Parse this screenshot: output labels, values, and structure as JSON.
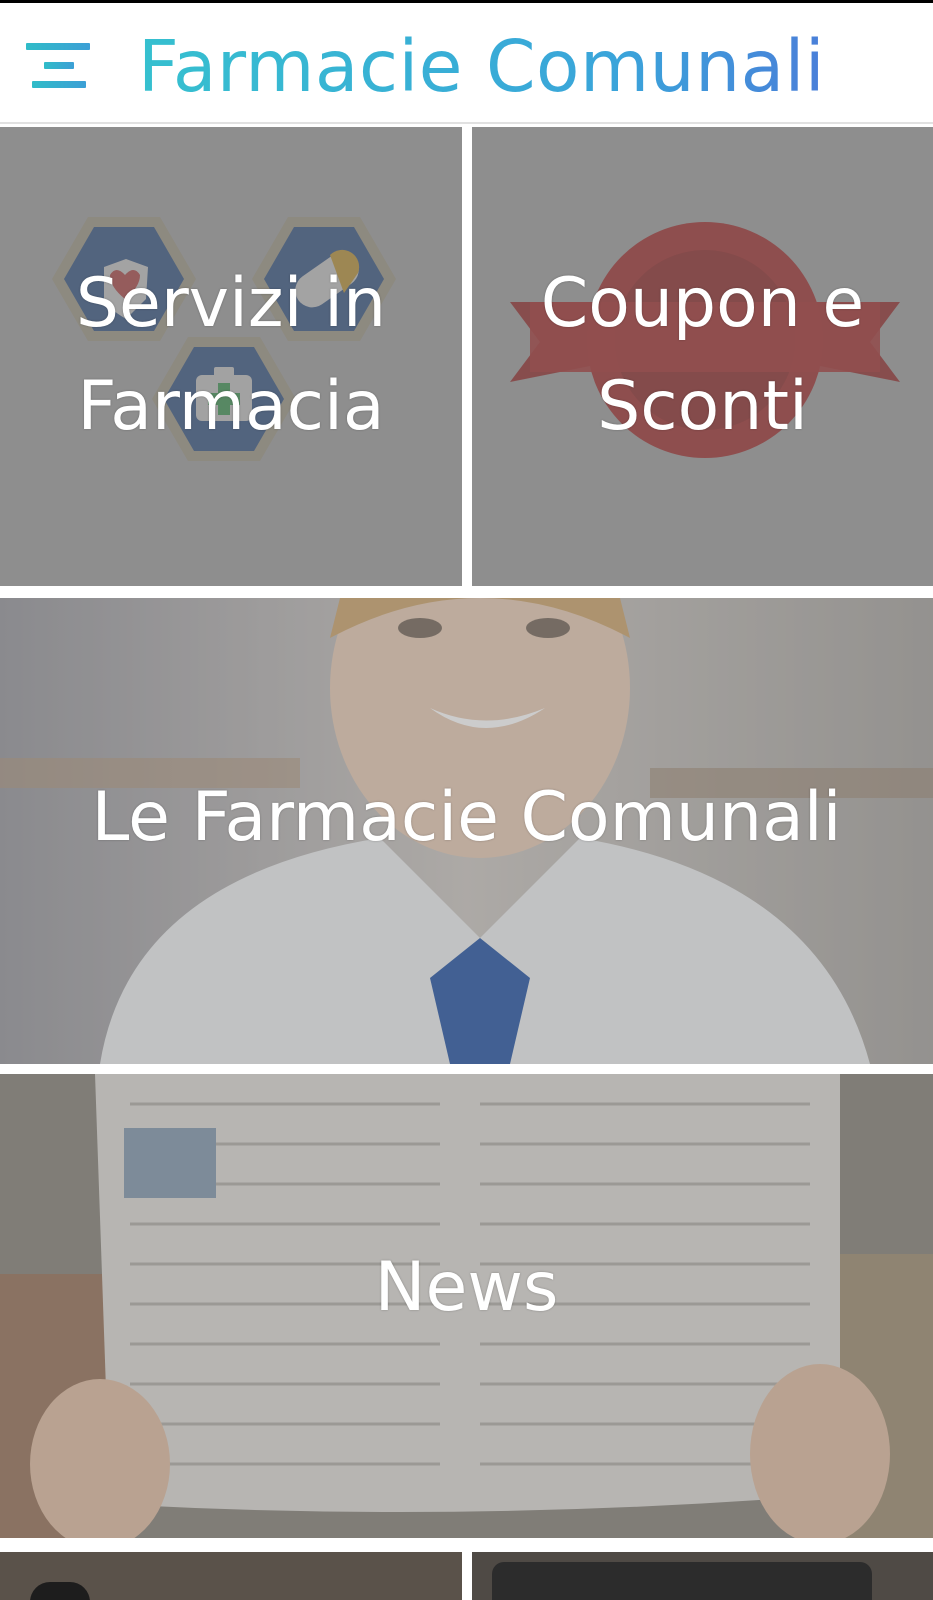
{
  "app": {
    "title": "Farmacie Comunali",
    "accent_colors": [
      "#36c0cf",
      "#3aa4da",
      "#4a7fd9"
    ]
  },
  "header": {
    "menu_icon": "hamburger-menu-icon",
    "title": "Farmacie Comunali"
  },
  "tiles": [
    {
      "label_line1": "Servizi in",
      "label_line2": "Farmacia",
      "icon": "pharmacy-services-hexagons-icon"
    },
    {
      "label_line1": "Coupon e",
      "label_line2": "Sconti",
      "icon": "coupon-seal-ribbon-icon"
    },
    {
      "label": "Le Farmacie Comunali",
      "image": "pharmacist-photo"
    },
    {
      "label": "News",
      "image": "newspaper-photo"
    }
  ]
}
